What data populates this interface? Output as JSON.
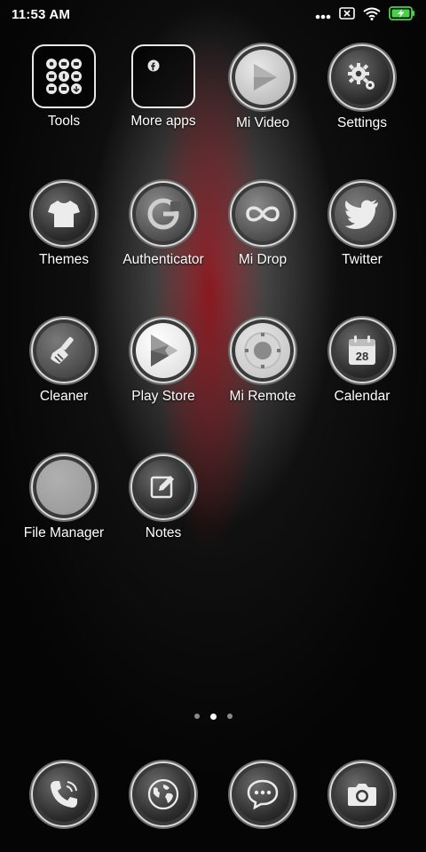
{
  "status": {
    "time": "11:53 AM",
    "icons": [
      "more-dots-icon",
      "sim-x-icon",
      "wifi-icon",
      "battery-charging-icon"
    ],
    "battery_color": "#47d147"
  },
  "apps": [
    {
      "name": "tools",
      "label": "Tools",
      "icon": "folder-icon"
    },
    {
      "name": "more-apps",
      "label": "More apps",
      "icon": "folder-icon"
    },
    {
      "name": "mi-video",
      "label": "Mi Video",
      "icon": "play-icon"
    },
    {
      "name": "settings",
      "label": "Settings",
      "icon": "gear-icon"
    },
    {
      "name": "themes",
      "label": "Themes",
      "icon": "tshirt-icon"
    },
    {
      "name": "authenticator",
      "label": "Authenticator",
      "icon": "google-g-icon"
    },
    {
      "name": "mi-drop",
      "label": "Mi Drop",
      "icon": "infinity-icon"
    },
    {
      "name": "twitter",
      "label": "Twitter",
      "icon": "bird-icon"
    },
    {
      "name": "cleaner",
      "label": "Cleaner",
      "icon": "broom-icon"
    },
    {
      "name": "play-store",
      "label": "Play Store",
      "icon": "play-store-icon"
    },
    {
      "name": "mi-remote",
      "label": "Mi Remote",
      "icon": "remote-dpad-icon"
    },
    {
      "name": "calendar",
      "label": "Calendar",
      "icon": "calendar-icon",
      "date": "28"
    },
    {
      "name": "file-manager",
      "label": "File Manager",
      "icon": "blank-circle-icon"
    },
    {
      "name": "notes",
      "label": "Notes",
      "icon": "note-edit-icon"
    }
  ],
  "pager": {
    "count": 3,
    "active_index": 1
  },
  "dock": [
    {
      "name": "phone",
      "icon": "phone-icon"
    },
    {
      "name": "browser",
      "icon": "globe-icon"
    },
    {
      "name": "messaging",
      "icon": "chat-bubble-icon"
    },
    {
      "name": "camera",
      "icon": "camera-icon"
    }
  ]
}
